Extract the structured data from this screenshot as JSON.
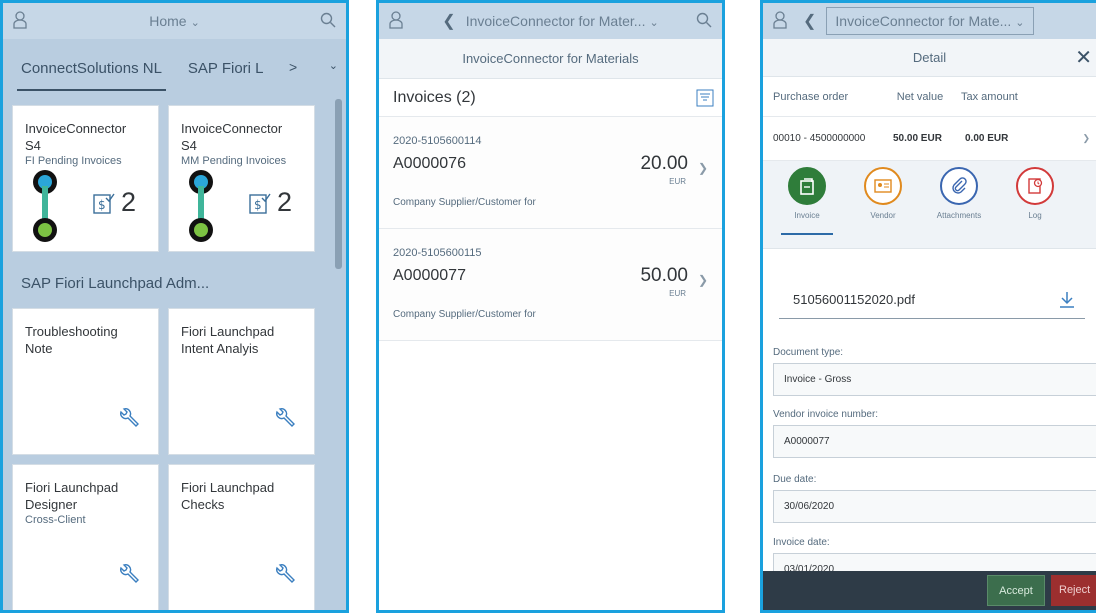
{
  "colors": {
    "brand_blue": "#1aa1de",
    "accent_green": "#3c6e4d",
    "reject_red": "#9c2f2f",
    "shell_bg": "#c6d7e7",
    "launchpad_bg": "#b9cde0"
  },
  "screen1": {
    "shell_title": "Home",
    "tabs": [
      "ConnectSolutions NL",
      "SAP Fiori L"
    ],
    "tab_more": ">",
    "tiles": [
      {
        "title1": "InvoiceConnector",
        "title2": "S4",
        "subtitle": "FI Pending Invoices",
        "count": "2",
        "icon": "invoice-check-icon"
      },
      {
        "title1": "InvoiceConnector",
        "title2": "S4",
        "subtitle": "MM Pending Invoices",
        "count": "2",
        "icon": "invoice-check-icon"
      }
    ],
    "group_title": "SAP Fiori Launchpad Adm...",
    "admin_tiles": [
      {
        "title1": "Troubleshooting",
        "title2": "Note",
        "subtitle": "",
        "icon": "wrench-icon"
      },
      {
        "title1": "Fiori Launchpad",
        "title2": "Intent Analyis",
        "subtitle": "",
        "icon": "wrench-icon"
      },
      {
        "title1": "Fiori Launchpad",
        "title2": "Designer",
        "subtitle": "Cross-Client",
        "icon": "wrench-icon"
      },
      {
        "title1": "Fiori Launchpad",
        "title2": "Checks",
        "subtitle": "",
        "icon": "wrench-icon"
      }
    ]
  },
  "screen2": {
    "shell_title": "InvoiceConnector for Mater...",
    "subtitle": "InvoiceConnector for Materials",
    "list_title": "Invoices (2)",
    "invoices": [
      {
        "id": "2020-5105600114",
        "number": "A0000076",
        "amount": "20.00",
        "currency": "EUR",
        "description": "Company Supplier/Customer for"
      },
      {
        "id": "2020-5105600115",
        "number": "A0000077",
        "amount": "50.00",
        "currency": "EUR",
        "description": "Company Supplier/Customer for"
      }
    ]
  },
  "screen3": {
    "shell_title": "InvoiceConnector for Mate...",
    "header": "Detail",
    "po_columns": [
      "Purchase order",
      "Net value",
      "Tax amount"
    ],
    "po_row": {
      "order": "00010 - 4500000000",
      "net": "50.00 EUR",
      "tax": "0.00 EUR"
    },
    "tabs": [
      {
        "label": "Invoice",
        "icon": "invoice-icon",
        "color": "#2f7d3a"
      },
      {
        "label": "Vendor",
        "icon": "vendor-card-icon",
        "color": "#e08a1e"
      },
      {
        "label": "Attachments",
        "icon": "paperclip-icon",
        "color": "#3a66b0"
      },
      {
        "label": "Log",
        "icon": "log-icon",
        "color": "#d23a3a"
      }
    ],
    "file_name": "51056001152020.pdf",
    "fields": [
      {
        "label": "Document type:",
        "value": "Invoice - Gross"
      },
      {
        "label": "Vendor invoice number:",
        "value": "A0000077"
      },
      {
        "label": "Due date:",
        "value": "30/06/2020"
      },
      {
        "label": "Invoice date:",
        "value": "03/01/2020"
      }
    ],
    "accept_label": "Accept",
    "reject_label": "Reject"
  }
}
